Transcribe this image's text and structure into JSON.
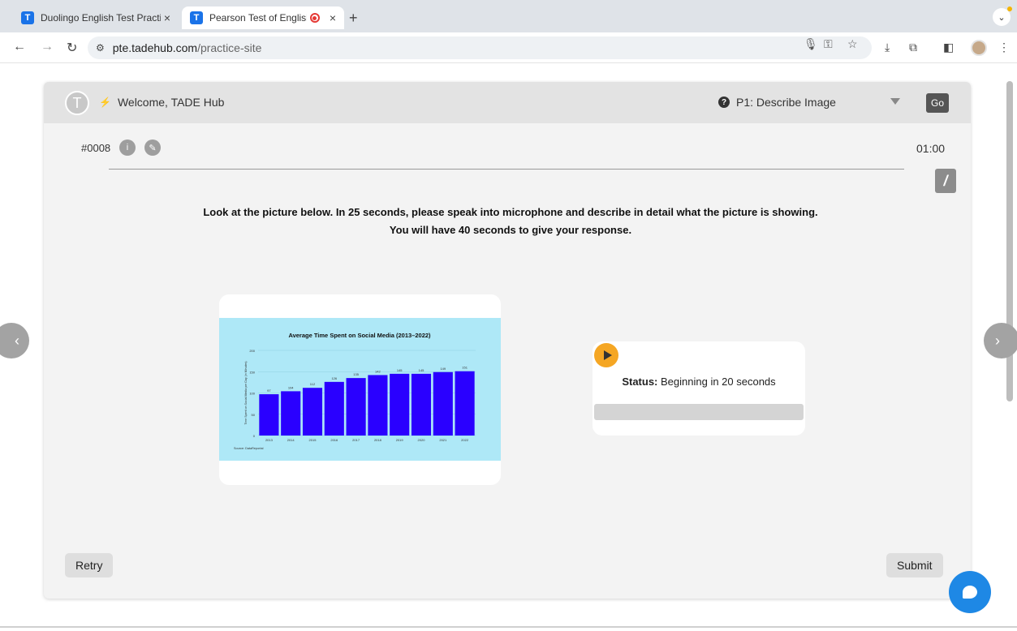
{
  "browser": {
    "tabs": [
      {
        "favicon": "T",
        "title": "Duolingo English Test Practic",
        "close": "×"
      },
      {
        "favicon": "T",
        "title": "Pearson Test of English P",
        "close": "×",
        "recording": true
      }
    ],
    "new_tab": "+",
    "url_host": "pte.tadehub.com",
    "url_path": "/practice-site"
  },
  "header": {
    "avatar_letter": "T",
    "welcome": "Welcome, TADE Hub",
    "task_label": "P1: Describe Image",
    "go_label": "Go"
  },
  "question": {
    "id": "#0008",
    "timer": "01:00",
    "instruction_line1": "Look at the picture below. In 25 seconds, please speak into microphone and describe in detail what the picture is showing.",
    "instruction_line2": "You will have 40 seconds to give your response."
  },
  "recorder": {
    "status_label": "Status:",
    "status_text": "Beginning in 20 seconds",
    "progress": 0
  },
  "actions": {
    "retry": "Retry",
    "submit": "Submit"
  },
  "colors": {
    "accent_play": "#f5a623",
    "chart_bg": "#aee8f7",
    "bar_color": "#2a00ff",
    "chat_fab": "#1e88e5"
  },
  "chart_data": {
    "type": "bar",
    "title": "Average Time Spent on Social Media (2013–2022)",
    "ylabel": "Time Spent on Social Media per Day (in Minutes)",
    "xlabel": "",
    "source": "Source: DataReportal",
    "categories": [
      "2013",
      "2014",
      "2015",
      "2016",
      "2017",
      "2018",
      "2019",
      "2020",
      "2021",
      "2022"
    ],
    "values": [
      97,
      104,
      112,
      126,
      135,
      142,
      145,
      145,
      149,
      151
    ],
    "value_labels": [
      "97",
      "104",
      "112",
      "126",
      "135",
      "142",
      "145",
      "145",
      "149",
      "151"
    ],
    "ylim": [
      0,
      200
    ],
    "yticks": [
      "0",
      "50",
      "100",
      "150",
      "200"
    ],
    "grid": true
  }
}
